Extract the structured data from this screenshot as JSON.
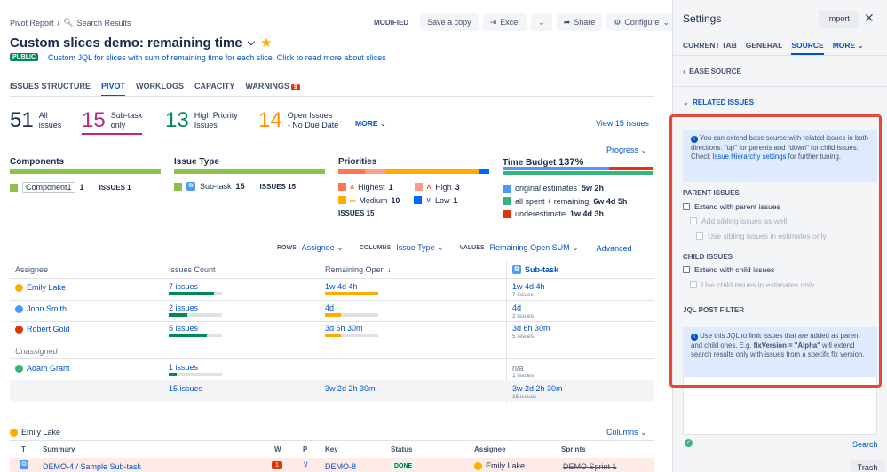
{
  "breadcrumb": {
    "part1": "Pivot Report",
    "sep": "/",
    "part2": "Search Results"
  },
  "toolbar": {
    "modified": "MODIFIED",
    "save_copy": "Save a copy",
    "excel": "Excel",
    "share": "Share",
    "configure": "Configure"
  },
  "header": {
    "title": "Custom slices demo: remaining time",
    "public_badge": "PUBLIC",
    "description": "Custom JQL for slices with sum of remaining time for each slice. Click to read more about slices"
  },
  "tabs": [
    "ISSUES STRUCTURE",
    "PIVOT",
    "WORKLOGS",
    "CAPACITY",
    "WARNINGS"
  ],
  "warnings_count": "9",
  "stats": [
    {
      "num": "51",
      "label1": "All",
      "label2": "issues",
      "color": "#172b4d"
    },
    {
      "num": "15",
      "label1": "Sub-task",
      "label2": "only",
      "color": "#c0267d"
    },
    {
      "num": "13",
      "label1": "High Priority",
      "label2": "Issues",
      "color": "#00875a"
    },
    {
      "num": "14",
      "label1": "Open Issues",
      "label2": "- No Due Date",
      "color": "#ff8b00"
    }
  ],
  "more": "MORE",
  "view_issues": "View 15 issues",
  "progress": "Progress",
  "groups": {
    "components": {
      "title": "Components",
      "item": "Component1",
      "count": "1",
      "issues": "ISSUES 1"
    },
    "issue_type": {
      "title": "Issue Type",
      "item": "Sub-task",
      "count": "15",
      "issues": "ISSUES 15"
    },
    "priorities": {
      "title": "Priorities",
      "items": [
        {
          "name": "Highest",
          "count": "1",
          "color": "#ff7452"
        },
        {
          "name": "High",
          "count": "3",
          "color": "#f99e8a"
        },
        {
          "name": "Medium",
          "count": "10",
          "color": "#ffab00"
        },
        {
          "name": "Low",
          "count": "1",
          "color": "#0065ff"
        }
      ],
      "issues": "ISSUES 15"
    },
    "time_budget": {
      "title": "Time Budget",
      "percent": "137%",
      "items": [
        {
          "label": "original estimates",
          "value": "5w 2h",
          "color": "#4c9aff"
        },
        {
          "label": "all spent + remaining",
          "value": "6w 4d 5h",
          "color": "#36b37e"
        },
        {
          "label": "underestimate",
          "value": "1w 4d 3h",
          "color": "#de350b"
        }
      ]
    }
  },
  "config": {
    "rows_k": "ROWS",
    "rows_v": "Assignee",
    "cols_k": "COLUMNS",
    "cols_v": "Issue Type",
    "vals_k": "VALUES",
    "vals_v": "Remaining Open SUM",
    "advanced": "Advanced"
  },
  "pivot": {
    "headers": [
      "Assignee",
      "Issues Count",
      "Remaining Open",
      "Sub-task"
    ],
    "rows": [
      {
        "name": "Emily Lake",
        "count": "7 issues",
        "remaining": "1w 4d 4h",
        "sub": "1w 4d 4h",
        "subcount": "7 issues",
        "fill": 0.85
      },
      {
        "name": "John Smith",
        "count": "2 issues",
        "remaining": "4d",
        "sub": "4d",
        "subcount": "2 issues",
        "fill": 0.35
      },
      {
        "name": "Robert Gold",
        "count": "5 issues",
        "remaining": "3d 6h 30m",
        "sub": "3d 6h 30m",
        "subcount": "5 issues",
        "fill": 0.6
      },
      {
        "name": "Unassigned"
      },
      {
        "name": "Adam Grant",
        "count": "1 issues",
        "remaining": "",
        "sub": "n/a",
        "subcount": "1 issues",
        "fill": 0.15
      }
    ],
    "total": {
      "count": "15 issues",
      "remaining": "3w 2d 2h 30m",
      "sub": "3w 2d 2h 30m",
      "subcount": "15 issues"
    }
  },
  "group_emily": "Emily Lake",
  "columns_btn": "Columns",
  "issues_table": {
    "headers": [
      "T",
      "Summary",
      "W",
      "P",
      "Key",
      "Status",
      "Assignee",
      "Sprints"
    ],
    "row": {
      "summary": "DEMO-4 /  Sample Sub-task",
      "w": "1",
      "key": "DEMO-8",
      "status": "DONE",
      "assignee": "Emily Lake",
      "sprint": "DEMO Sprint 1"
    }
  },
  "settings": {
    "title": "Settings",
    "import": "Import",
    "tabs": [
      "CURRENT TAB",
      "GENERAL",
      "SOURCE",
      "MORE"
    ],
    "base_source": "BASE SOURCE",
    "related_issues": "RELATED ISSUES",
    "info1_pre": "You can extend base source with related issues in both directions: \"up\" for parents and \"down\" for child issues. Check ",
    "info1_link": "Issue Hierarchy settings",
    "info1_post": " for further tuning.",
    "parent_issues": "PARENT ISSUES",
    "extend_parent": "Extend with parent issues",
    "add_sibling": "Add sibling issues as well",
    "use_sibling": "Use sibling issues in estimates only",
    "child_issues": "CHILD ISSUES",
    "extend_child": "Extend with child issues",
    "use_child": "Use child issues in estimates only",
    "jql_post": "JQL POST FILTER",
    "info2_pre": "Use this JQL to limit issues that are added as parent and child ones. E.g. ",
    "info2_code": "fixVersion = \"Alpha\"",
    "info2_post": " will extend search results only with issues from a specifc fix version.",
    "search": "Search",
    "trash": "Trash"
  }
}
